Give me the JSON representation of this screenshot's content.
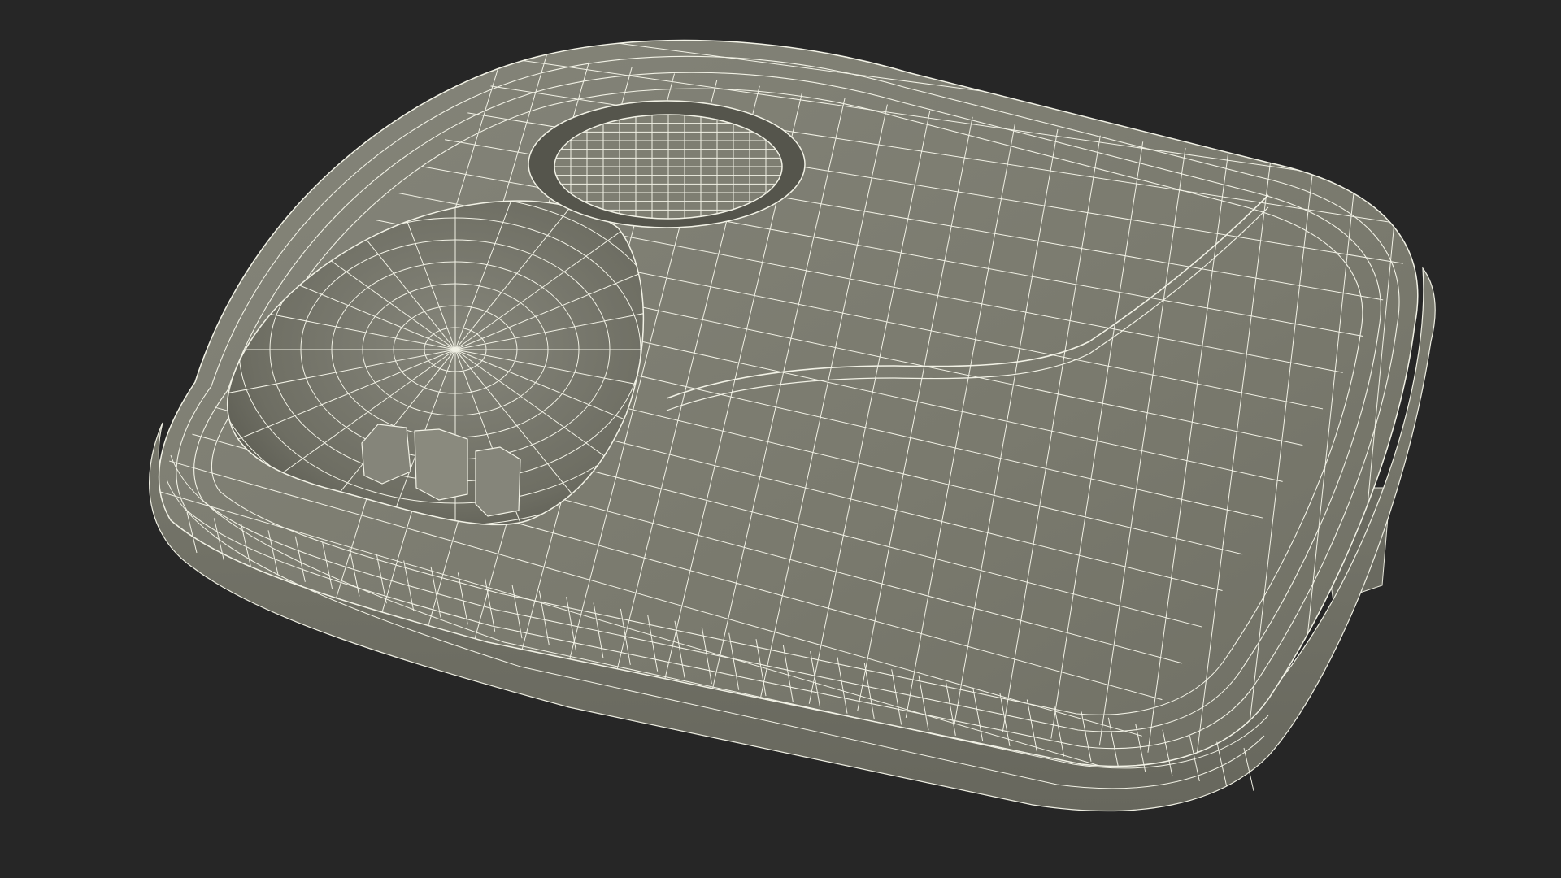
{
  "scene": {
    "subject": "wireframe-render",
    "background_color": "#262626",
    "surface_color": "#7a7a6e",
    "surface_light_color": "#8a8a7e",
    "surface_dark_color": "#5e5e54",
    "wire_color": "#f2f2e6"
  }
}
